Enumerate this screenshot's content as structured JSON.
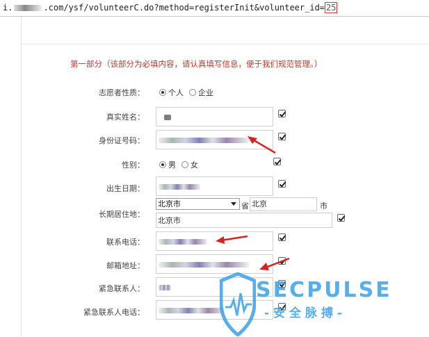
{
  "browser": {
    "url_prefix": "i.",
    "url_main": ".com/ysf/volunteerC.do?method=registerInit&volunteer_id=",
    "url_id": "25"
  },
  "form": {
    "section_title": "第一部分（该部分为必填内容，请认真填写信息，便于我们规范管理。）",
    "volunteer_type": {
      "label": "志愿者性质：",
      "options": [
        "个人",
        "企业"
      ],
      "selected": "个人"
    },
    "real_name": {
      "label": "真实姓名："
    },
    "id_number": {
      "label": "身份证号码："
    },
    "gender": {
      "label": "性别：",
      "options": [
        "男",
        "女"
      ],
      "selected": "男"
    },
    "birth_date": {
      "label": "出生日期："
    },
    "residence": {
      "label": "长期居住地：",
      "province_select": "北京市",
      "province_suffix": "省",
      "city_value": "北京",
      "city_suffix": "市",
      "detail_value": "北京市"
    },
    "phone": {
      "label": "联系电话："
    },
    "address": {
      "label": "邮箱地址："
    },
    "emergency_contact": {
      "label": "紧急联系人："
    },
    "emergency_phone": {
      "label": "紧急联系人电话："
    }
  },
  "watermark": {
    "brand": "SECPULSE",
    "slogan": "-安全脉搏-",
    "color": "#3aa0e6"
  },
  "colors": {
    "section_title": "#c0392b",
    "annotation_arrow": "#d9231f"
  }
}
